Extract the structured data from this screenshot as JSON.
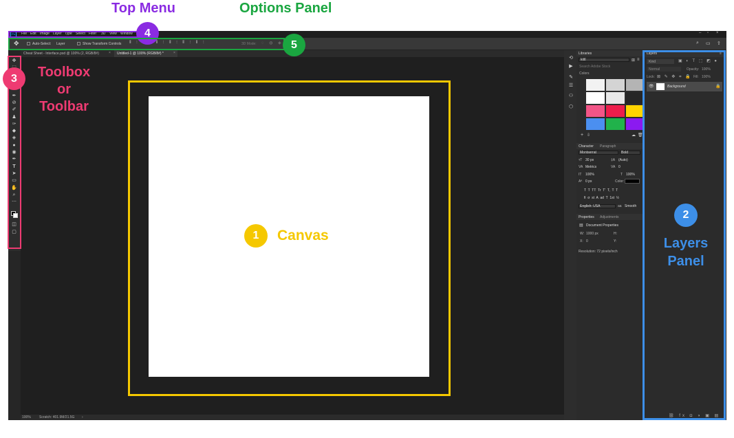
{
  "annotations": {
    "top_menu": {
      "number": "4",
      "title": "Top Menu",
      "color": "#8a2be2"
    },
    "options_panel": {
      "number": "5",
      "title": "Options Panel",
      "color": "#1aa640"
    },
    "toolbox": {
      "number": "3",
      "title_line1": "Toolbox",
      "title_line2": "or",
      "title_line3": "Toolbar",
      "color": "#ee3b72"
    },
    "canvas": {
      "number": "1",
      "title": "Canvas",
      "color": "#f5c800"
    },
    "layers_panel": {
      "number": "2",
      "title_line1": "Layers",
      "title_line2": "Panel",
      "color": "#3d8fe8"
    }
  },
  "menubar": {
    "app_icon": "Ps",
    "items": [
      "File",
      "Edit",
      "Image",
      "Layer",
      "Type",
      "Select",
      "Filter",
      "3D",
      "View",
      "Window"
    ]
  },
  "optionsbar": {
    "move_icon": "move-icon",
    "auto_select_label": "Auto-Select:",
    "auto_select_value": "Layer",
    "transform_label": "Show Transform Controls",
    "mode_label": "3D Mode:"
  },
  "tabs": [
    {
      "label": "Cheat Sheet - Interface.psd @ 100% (2, RGB/8#)"
    },
    {
      "label": "Untitled-1 @ 100% (RGB/8#) *"
    }
  ],
  "status": {
    "zoom": "100%",
    "scratch": "Scratch: 401.9M/21.5G"
  },
  "libraries": {
    "tab": "Libraries",
    "library_name": "kittl",
    "search_placeholder": "Search Adobe Stock",
    "colors_label": "Colors",
    "swatches": [
      "#f2f2f2",
      "#d4d4d4",
      "#b4b4b4",
      "#ffffff",
      "#e8e8e8",
      "#262626",
      "#f25587",
      "#ee1d4b",
      "#ffd400",
      "#4b8ff0",
      "#21b24b",
      "#8b1af0"
    ]
  },
  "character": {
    "tab_character": "Character",
    "tab_paragraph": "Paragraph",
    "font_family": "Montserrat",
    "font_style": "Bold",
    "size": "30 px",
    "leading": "(Auto)",
    "kerning": "Metrics",
    "tracking": "0",
    "vscale": "100%",
    "hscale": "100%",
    "baseline": "0 px",
    "color_label": "Color:",
    "style_buttons": "T  T  TT  Tr  T'  T,  T  T",
    "opentype_buttons": "fi  σ  st  A  ad  T  1st  ½",
    "language": "English: USA",
    "aa_label": "aa",
    "antialias": "Smooth"
  },
  "properties": {
    "tab_properties": "Properties",
    "tab_adjustments": "Adjustments",
    "doc_title": "Document Properties",
    "w_label": "W:",
    "w_value": "1000 px",
    "h_label": "H:",
    "x_label": "X:",
    "x_value": "0",
    "y_label": "Y:",
    "resolution": "Resolution: 72 pixels/inch"
  },
  "layers": {
    "tab": "Layers",
    "kind_placeholder": "Kind",
    "blend_mode": "Normal",
    "opacity_label": "Opacity:",
    "opacity_value": "100%",
    "lock_label": "Lock:",
    "fill_label": "Fill:",
    "fill_value": "100%",
    "rows": [
      {
        "name": "Background"
      }
    ]
  }
}
